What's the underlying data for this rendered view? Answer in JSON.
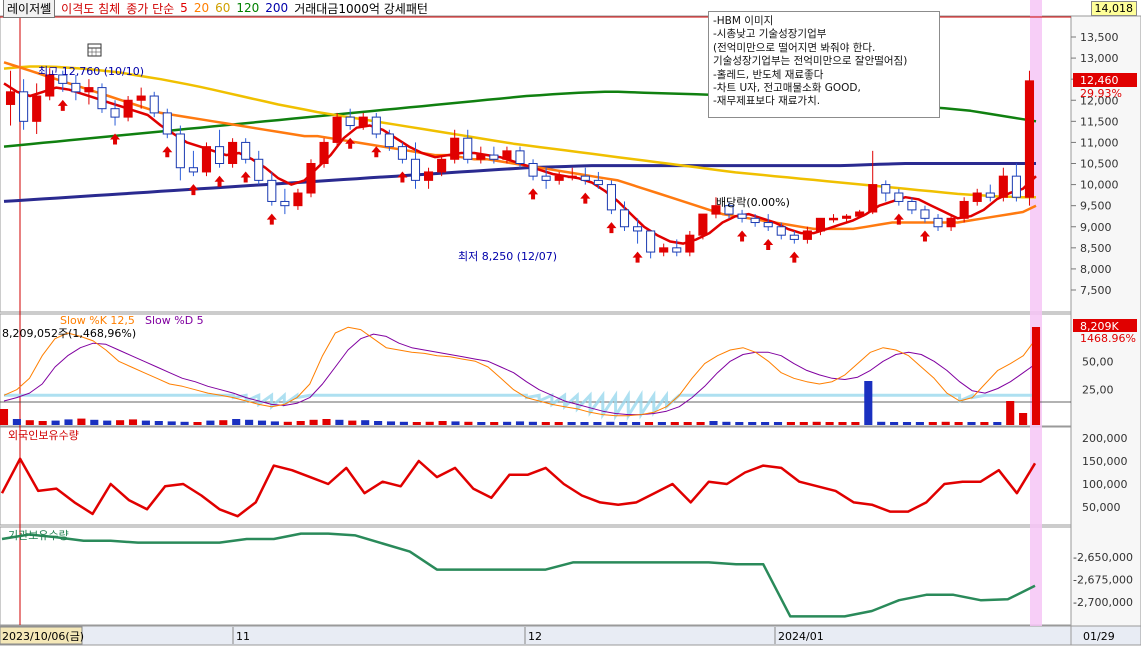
{
  "toolbar": {
    "name_label": "레이저쎌",
    "envelope_label": "이격도 침체",
    "ma_label": "종가 단순",
    "ma_periods": [
      "5",
      "20",
      "60",
      "120",
      "200"
    ],
    "ma_colors": [
      "#e00000",
      "#ff7f00",
      "#f0c000",
      "#008000",
      "#0000aa"
    ],
    "volume_label": "거래대금1000억 강세패턴",
    "top_price": "14,018"
  },
  "memo": {
    "lines": [
      "-HBM 이미지",
      "-시총낮고 기술성장기업부",
      "(전억미만으로 떨어지면 봐줘야 한다.",
      "기술성장기업부는 전억미만으로 잘안떨어짐)",
      "-홀레드, 반도체 재료좋다",
      "-차트 U자, 전고매물소화 GOOD,",
      "-재무제표보다 재료가치."
    ]
  },
  "annotations": {
    "high_label": "최고 12,760 (10/10)",
    "low_label": "최저 8,250 (12/07)",
    "dividend_label": "배당락(0.00%)"
  },
  "price_axis": [
    "13,500",
    "13,000",
    "12,500",
    "12,000",
    "11,500",
    "11,000",
    "10,500",
    "10,000",
    "9,500",
    "9,000",
    "8,500",
    "8,000",
    "7,500"
  ],
  "current_price": {
    "value": "12,460",
    "change": "29.93%"
  },
  "stoch": {
    "label_k": "Slow %K 12,5",
    "label_d": "Slow %D 5",
    "axis": [
      "50,00",
      "25,00"
    ]
  },
  "volume": {
    "label": "8,209,052주(1,468,96%)",
    "current": "8,209K",
    "current_pct": "1468.96%"
  },
  "foreign": {
    "label": "외국인보유수량",
    "axis": [
      "200,000",
      "150,000",
      "100,000",
      "50,000"
    ]
  },
  "inst": {
    "label": "기관보유수량",
    "axis": [
      "-2,650,000",
      "-2,675,000",
      "-2,700,000"
    ]
  },
  "date_axis": {
    "start": "2023/10/06(금)",
    "labels": [
      "11",
      "12",
      "2024/01"
    ],
    "end": "01/29"
  },
  "chart_data": {
    "type": "candlestick",
    "title": "레이저쎌",
    "ylim": [
      7200,
      14000
    ],
    "candles": [
      {
        "o": 11900,
        "h": 12700,
        "l": 11400,
        "c": 12200
      },
      {
        "o": 12200,
        "h": 12500,
        "l": 11300,
        "c": 11500
      },
      {
        "o": 11500,
        "h": 12400,
        "l": 11200,
        "c": 12100
      },
      {
        "o": 12100,
        "h": 12760,
        "l": 12000,
        "c": 12600
      },
      {
        "o": 12600,
        "h": 12700,
        "l": 12200,
        "c": 12400
      },
      {
        "o": 12400,
        "h": 12600,
        "l": 12000,
        "c": 12200
      },
      {
        "o": 12200,
        "h": 12500,
        "l": 11900,
        "c": 12300
      },
      {
        "o": 12300,
        "h": 12400,
        "l": 11700,
        "c": 11800
      },
      {
        "o": 11800,
        "h": 12000,
        "l": 11400,
        "c": 11600
      },
      {
        "o": 11600,
        "h": 12100,
        "l": 11500,
        "c": 12000
      },
      {
        "o": 12000,
        "h": 12300,
        "l": 11800,
        "c": 12100
      },
      {
        "o": 12100,
        "h": 12200,
        "l": 11600,
        "c": 11700
      },
      {
        "o": 11700,
        "h": 11800,
        "l": 11100,
        "c": 11200
      },
      {
        "o": 11200,
        "h": 11400,
        "l": 10100,
        "c": 10400
      },
      {
        "o": 10400,
        "h": 10800,
        "l": 10200,
        "c": 10300
      },
      {
        "o": 10300,
        "h": 11000,
        "l": 10200,
        "c": 10900
      },
      {
        "o": 10900,
        "h": 11300,
        "l": 10400,
        "c": 10500
      },
      {
        "o": 10500,
        "h": 11100,
        "l": 10400,
        "c": 11000
      },
      {
        "o": 11000,
        "h": 11100,
        "l": 10500,
        "c": 10600
      },
      {
        "o": 10600,
        "h": 10800,
        "l": 10000,
        "c": 10100
      },
      {
        "o": 10100,
        "h": 10300,
        "l": 9500,
        "c": 9600
      },
      {
        "o": 9600,
        "h": 9900,
        "l": 9300,
        "c": 9500
      },
      {
        "o": 9500,
        "h": 9900,
        "l": 9400,
        "c": 9800
      },
      {
        "o": 9800,
        "h": 10600,
        "l": 9700,
        "c": 10500
      },
      {
        "o": 10500,
        "h": 11100,
        "l": 10400,
        "c": 11000
      },
      {
        "o": 11000,
        "h": 11700,
        "l": 10900,
        "c": 11600
      },
      {
        "o": 11600,
        "h": 11800,
        "l": 11300,
        "c": 11400
      },
      {
        "o": 11400,
        "h": 11700,
        "l": 11300,
        "c": 11600
      },
      {
        "o": 11600,
        "h": 11700,
        "l": 11100,
        "c": 11200
      },
      {
        "o": 11200,
        "h": 11300,
        "l": 10800,
        "c": 10900
      },
      {
        "o": 10900,
        "h": 11000,
        "l": 10500,
        "c": 10600
      },
      {
        "o": 10600,
        "h": 11000,
        "l": 9900,
        "c": 10100
      },
      {
        "o": 10100,
        "h": 10400,
        "l": 9900,
        "c": 10300
      },
      {
        "o": 10300,
        "h": 10700,
        "l": 10200,
        "c": 10600
      },
      {
        "o": 10600,
        "h": 11300,
        "l": 10500,
        "c": 11100
      },
      {
        "o": 11100,
        "h": 11300,
        "l": 10500,
        "c": 10600
      },
      {
        "o": 10600,
        "h": 10900,
        "l": 10500,
        "c": 10700
      },
      {
        "o": 10700,
        "h": 10900,
        "l": 10500,
        "c": 10600
      },
      {
        "o": 10600,
        "h": 10900,
        "l": 10500,
        "c": 10800
      },
      {
        "o": 10800,
        "h": 10900,
        "l": 10400,
        "c": 10500
      },
      {
        "o": 10500,
        "h": 10600,
        "l": 10100,
        "c": 10200
      },
      {
        "o": 10200,
        "h": 10400,
        "l": 9900,
        "c": 10100
      },
      {
        "o": 10100,
        "h": 10300,
        "l": 10000,
        "c": 10200
      },
      {
        "o": 10200,
        "h": 10400,
        "l": 10100,
        "c": 10200
      },
      {
        "o": 10200,
        "h": 10400,
        "l": 10000,
        "c": 10100
      },
      {
        "o": 10100,
        "h": 10300,
        "l": 9900,
        "c": 10000
      },
      {
        "o": 10000,
        "h": 10100,
        "l": 9300,
        "c": 9400
      },
      {
        "o": 9400,
        "h": 9600,
        "l": 8900,
        "c": 9000
      },
      {
        "o": 9000,
        "h": 9200,
        "l": 8600,
        "c": 8900
      },
      {
        "o": 8900,
        "h": 8900,
        "l": 8250,
        "c": 8400
      },
      {
        "o": 8400,
        "h": 8600,
        "l": 8300,
        "c": 8500
      },
      {
        "o": 8500,
        "h": 8700,
        "l": 8300,
        "c": 8400
      },
      {
        "o": 8400,
        "h": 8900,
        "l": 8300,
        "c": 8800
      },
      {
        "o": 8800,
        "h": 9300,
        "l": 8700,
        "c": 9300
      },
      {
        "o": 9300,
        "h": 9700,
        "l": 9200,
        "c": 9500
      },
      {
        "o": 9500,
        "h": 9600,
        "l": 9200,
        "c": 9300
      },
      {
        "o": 9300,
        "h": 9400,
        "l": 9100,
        "c": 9200
      },
      {
        "o": 9200,
        "h": 9300,
        "l": 9000,
        "c": 9100
      },
      {
        "o": 9100,
        "h": 9300,
        "l": 8900,
        "c": 9000
      },
      {
        "o": 9000,
        "h": 9100,
        "l": 8700,
        "c": 8800
      },
      {
        "o": 8800,
        "h": 8900,
        "l": 8600,
        "c": 8700
      },
      {
        "o": 8700,
        "h": 9000,
        "l": 8600,
        "c": 8900
      },
      {
        "o": 8900,
        "h": 9200,
        "l": 8800,
        "c": 9200
      },
      {
        "o": 9200,
        "h": 9300,
        "l": 9100,
        "c": 9200
      },
      {
        "o": 9200,
        "h": 9300,
        "l": 9100,
        "c": 9250
      },
      {
        "o": 9250,
        "h": 9400,
        "l": 9200,
        "c": 9350
      },
      {
        "o": 9350,
        "h": 10800,
        "l": 9300,
        "c": 10000
      },
      {
        "o": 10000,
        "h": 10100,
        "l": 9600,
        "c": 9800
      },
      {
        "o": 9800,
        "h": 9900,
        "l": 9500,
        "c": 9600
      },
      {
        "o": 9600,
        "h": 9700,
        "l": 9300,
        "c": 9400
      },
      {
        "o": 9400,
        "h": 9500,
        "l": 9100,
        "c": 9200
      },
      {
        "o": 9200,
        "h": 9300,
        "l": 8900,
        "c": 9000
      },
      {
        "o": 9000,
        "h": 9300,
        "l": 8900,
        "c": 9200
      },
      {
        "o": 9200,
        "h": 9700,
        "l": 9100,
        "c": 9600
      },
      {
        "o": 9600,
        "h": 9900,
        "l": 9500,
        "c": 9800
      },
      {
        "o": 9800,
        "h": 10000,
        "l": 9600,
        "c": 9700
      },
      {
        "o": 9700,
        "h": 10400,
        "l": 9600,
        "c": 10200
      },
      {
        "o": 10200,
        "h": 10500,
        "l": 9600,
        "c": 9700
      },
      {
        "o": 9700,
        "h": 12700,
        "l": 9500,
        "c": 12460
      }
    ],
    "ma5": [
      12400,
      12200,
      12100,
      12200,
      12300,
      12250,
      12150,
      12050,
      11950,
      11850,
      11750,
      11650,
      11400,
      11200,
      11000,
      10900,
      10800,
      10700,
      10750,
      10600,
      10400,
      10150,
      10000,
      10100,
      10400,
      10700,
      11100,
      11350,
      11400,
      11300,
      11100,
      10900,
      10750,
      10650,
      10700,
      10750,
      10750,
      10700,
      10650,
      10550,
      10450,
      10350,
      10250,
      10200,
      10150,
      10050,
      9850,
      9600,
      9300,
      9000,
      8800,
      8650,
      8600,
      8700,
      8850,
      9100,
      9250,
      9300,
      9200,
      9100,
      8950,
      8850,
      8850,
      8950,
      9050,
      9150,
      9300,
      9500,
      9600,
      9700,
      9650,
      9500,
      9350,
      9200,
      9250,
      9400,
      9650,
      9800,
      9900,
      10200
    ],
    "ma20": [
      12900,
      12800,
      12700,
      12600,
      12500,
      12400,
      12300,
      12200,
      12100,
      12000,
      11900,
      11800,
      11700,
      11650,
      11600,
      11550,
      11500,
      11450,
      11400,
      11350,
      11300,
      11250,
      11200,
      11150,
      11150,
      11100,
      11050,
      11000,
      10950,
      10900,
      10850,
      10800,
      10750,
      10700,
      10700,
      10650,
      10600,
      10600,
      10550,
      10500,
      10450,
      10400,
      10350,
      10300,
      10250,
      10200,
      10150,
      10100,
      10000,
      9900,
      9800,
      9700,
      9600,
      9500,
      9400,
      9300,
      9250,
      9200,
      9150,
      9100,
      9050,
      9000,
      8950,
      8950,
      8950,
      8950,
      9000,
      9050,
      9100,
      9100,
      9100,
      9100,
      9100,
      9100,
      9150,
      9200,
      9250,
      9300,
      9350,
      9500
    ],
    "ma60": [
      12750,
      12780,
      12800,
      12800,
      12790,
      12770,
      12750,
      12720,
      12690,
      12650,
      12600,
      12550,
      12500,
      12440,
      12380,
      12320,
      12250,
      12180,
      12110,
      12040,
      11970,
      11900,
      11840,
      11780,
      11720,
      11670,
      11620,
      11570,
      11520,
      11470,
      11420,
      11370,
      11320,
      11270,
      11220,
      11170,
      11120,
      11070,
      11020,
      10970,
      10930,
      10890,
      10850,
      10810,
      10770,
      10730,
      10690,
      10650,
      10610,
      10570,
      10530,
      10490,
      10450,
      10410,
      10370,
      10330,
      10290,
      10260,
      10230,
      10200,
      10170,
      10140,
      10110,
      10080,
      10050,
      10020,
      9990,
      9960,
      9930,
      9900,
      9870,
      9840,
      9810,
      9780,
      9760,
      9740,
      9720,
      9710,
      9700,
      9700
    ],
    "ma120": [
      10900,
      10930,
      10960,
      10990,
      11020,
      11050,
      11080,
      11110,
      11140,
      11170,
      11200,
      11230,
      11260,
      11290,
      11320,
      11350,
      11380,
      11410,
      11440,
      11470,
      11500,
      11530,
      11560,
      11590,
      11620,
      11650,
      11680,
      11710,
      11740,
      11770,
      11800,
      11830,
      11860,
      11890,
      11920,
      11950,
      11980,
      12010,
      12040,
      12070,
      12100,
      12120,
      12140,
      12160,
      12180,
      12190,
      12200,
      12200,
      12190,
      12180,
      12170,
      12160,
      12150,
      12140,
      12130,
      12120,
      12110,
      12100,
      12090,
      12070,
      12050,
      12030,
      12010,
      11990,
      11970,
      11950,
      11930,
      11910,
      11890,
      11870,
      11850,
      11830,
      11810,
      11780,
      11750,
      11700,
      11650,
      11600,
      11550,
      11500
    ],
    "ma200": [
      9600,
      9620,
      9640,
      9660,
      9680,
      9700,
      9720,
      9740,
      9760,
      9780,
      9800,
      9820,
      9840,
      9860,
      9880,
      9900,
      9920,
      9940,
      9960,
      9980,
      10000,
      10020,
      10040,
      10060,
      10080,
      10100,
      10120,
      10140,
      10160,
      10180,
      10200,
      10220,
      10240,
      10260,
      10280,
      10300,
      10320,
      10340,
      10360,
      10380,
      10400,
      10410,
      10420,
      10430,
      10440,
      10450,
      10450,
      10450,
      10450,
      10450,
      10450,
      10450,
      10450,
      10450,
      10450,
      10450,
      10450,
      10450,
      10450,
      10450,
      10450,
      10450,
      10450,
      10450,
      10450,
      10460,
      10470,
      10480,
      10490,
      10500,
      10500,
      10500,
      10500,
      10500,
      10500,
      10500,
      10500,
      10500,
      10500,
      10500
    ],
    "stoch_k": [
      20,
      25,
      35,
      55,
      70,
      75,
      72,
      68,
      60,
      50,
      45,
      40,
      35,
      30,
      28,
      25,
      22,
      20,
      18,
      15,
      12,
      10,
      12,
      18,
      30,
      55,
      75,
      80,
      78,
      70,
      62,
      60,
      58,
      57,
      55,
      54,
      52,
      50,
      45,
      35,
      25,
      18,
      15,
      12,
      10,
      8,
      5,
      3,
      2,
      2,
      3,
      5,
      10,
      20,
      35,
      48,
      55,
      60,
      62,
      58,
      50,
      40,
      35,
      32,
      30,
      32,
      38,
      48,
      58,
      62,
      60,
      55,
      45,
      35,
      22,
      15,
      18,
      30,
      42,
      48,
      55,
      70
    ],
    "stoch_d": [
      15,
      18,
      22,
      30,
      45,
      55,
      62,
      66,
      65,
      60,
      55,
      50,
      45,
      40,
      35,
      32,
      28,
      25,
      22,
      18,
      15,
      12,
      11,
      13,
      18,
      30,
      45,
      60,
      70,
      74,
      72,
      66,
      62,
      60,
      58,
      56,
      54,
      52,
      50,
      45,
      40,
      32,
      25,
      20,
      15,
      12,
      9,
      6,
      4,
      3,
      3,
      4,
      6,
      10,
      18,
      28,
      40,
      50,
      56,
      58,
      58,
      55,
      48,
      42,
      38,
      35,
      34,
      36,
      42,
      50,
      56,
      58,
      56,
      50,
      42,
      32,
      24,
      22,
      26,
      32,
      40,
      48
    ],
    "volume_k": [
      400,
      150,
      120,
      100,
      110,
      140,
      160,
      130,
      110,
      120,
      140,
      110,
      100,
      90,
      80,
      70,
      110,
      120,
      150,
      130,
      110,
      90,
      80,
      100,
      130,
      150,
      130,
      110,
      120,
      100,
      90,
      80,
      70,
      80,
      100,
      90,
      80,
      70,
      60,
      80,
      90,
      80,
      70,
      60,
      50,
      60,
      70,
      80,
      50,
      40,
      30,
      30,
      40,
      50,
      60,
      100,
      80,
      70,
      60,
      50,
      50,
      60,
      60,
      80,
      70,
      60,
      50,
      1100,
      80,
      60,
      50,
      40,
      50,
      80,
      70,
      50,
      60,
      40,
      600,
      300,
      8209
    ],
    "foreign": [
      80000,
      155000,
      85000,
      90000,
      60000,
      35000,
      100000,
      65000,
      45000,
      95000,
      100000,
      75000,
      45000,
      30000,
      60000,
      140000,
      130000,
      115000,
      100000,
      135000,
      80000,
      105000,
      95000,
      150000,
      115000,
      135000,
      90000,
      70000,
      120000,
      120000,
      135000,
      100000,
      75000,
      60000,
      55000,
      60000,
      80000,
      100000,
      60000,
      105000,
      100000,
      125000,
      140000,
      135000,
      105000,
      95000,
      85000,
      60000,
      55000,
      40000,
      40000,
      60000,
      100000,
      105000,
      105000,
      130000,
      80000,
      145000
    ],
    "inst": [
      -2630000,
      -2625000,
      -2628000,
      -2632000,
      -2632000,
      -2634000,
      -2634000,
      -2634000,
      -2634000,
      -2630000,
      -2630000,
      -2624000,
      -2624000,
      -2626000,
      -2635000,
      -2644000,
      -2664000,
      -2664000,
      -2664000,
      -2664000,
      -2664000,
      -2656000,
      -2656000,
      -2656000,
      -2656000,
      -2656000,
      -2656000,
      -2658000,
      -2658000,
      -2716000,
      -2716000,
      -2716000,
      -2710000,
      -2698000,
      -2692000,
      -2692000,
      -2698000,
      -2697000,
      -2682000
    ]
  }
}
